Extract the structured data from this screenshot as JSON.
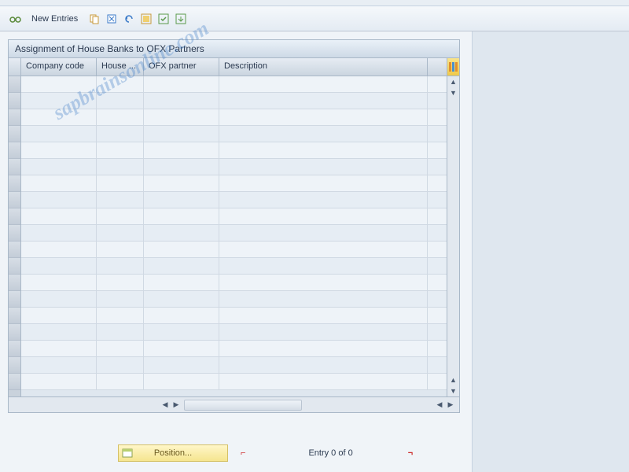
{
  "toolbar": {
    "new_entries_label": "New Entries"
  },
  "panel": {
    "title": "Assignment of House Banks to OFX Partners"
  },
  "columns": {
    "company_code": "Company code",
    "house": "House ...",
    "ofx_partner": "OFX partner",
    "description": "Description"
  },
  "footer": {
    "position_label": "Position...",
    "entry_text": "Entry 0 of 0"
  },
  "watermark": "sapbrainsonline.com"
}
